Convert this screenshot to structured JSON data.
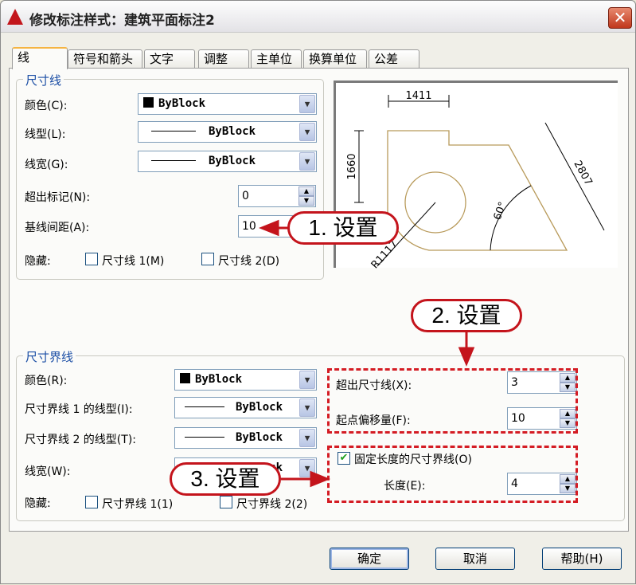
{
  "window": {
    "title": "修改标注样式：建筑平面标注2",
    "close_label": "✕"
  },
  "tabs": [
    {
      "label": "线",
      "active": true
    },
    {
      "label": "符号和箭头"
    },
    {
      "label": "文字"
    },
    {
      "label": "调整"
    },
    {
      "label": "主单位"
    },
    {
      "label": "换算单位"
    },
    {
      "label": "公差"
    }
  ],
  "dim_lines": {
    "legend": "尺寸线",
    "color_label": "颜色(C):",
    "color_value": "ByBlock",
    "linetype_label": "线型(L):",
    "linetype_value": "ByBlock",
    "lineweight_label": "线宽(G):",
    "lineweight_value": "ByBlock",
    "extend_ticks_label": "超出标记(N):",
    "extend_ticks_value": "0",
    "baseline_spacing_label": "基线间距(A):",
    "baseline_spacing_value": "10",
    "suppress_label": "隐藏:",
    "suppress_1_label": "尺寸线 1(M)",
    "suppress_1_checked": false,
    "suppress_2_label": "尺寸线 2(D)",
    "suppress_2_checked": false
  },
  "ext_lines": {
    "legend": "尺寸界线",
    "color_label": "颜色(R):",
    "color_value": "ByBlock",
    "linetype1_label": "尺寸界线 1 的线型(I):",
    "linetype1_value": "ByBlock",
    "linetype2_label": "尺寸界线 2 的线型(T):",
    "linetype2_value": "ByBlock",
    "lineweight_label": "线宽(W):",
    "lineweight_value": "ByBlock",
    "suppress_label": "隐藏:",
    "suppress_1_label": "尺寸界线 1(1)",
    "suppress_1_checked": false,
    "suppress_2_label": "尺寸界线 2(2)",
    "suppress_2_checked": false,
    "extend_beyond_label": "超出尺寸线(X):",
    "extend_beyond_value": "3",
    "offset_label": "起点偏移量(F):",
    "offset_value": "10",
    "fixed_length_label": "固定长度的尺寸界线(O)",
    "fixed_length_checked": true,
    "length_label": "长度(E):",
    "length_value": "4"
  },
  "preview": {
    "dim_top": "1411",
    "dim_left": "1660",
    "dim_diag": "2807",
    "angle": "60°",
    "radius": "R1117"
  },
  "callouts": {
    "c1": "1. 设置",
    "c2": "2. 设置",
    "c3": "3. 设置"
  },
  "buttons": {
    "ok": "确定",
    "cancel": "取消",
    "help": "帮助(H)"
  },
  "colors": {
    "accent_red": "#c4141c",
    "legend_blue": "#1b4ea5",
    "shape": "#b89a5a"
  }
}
